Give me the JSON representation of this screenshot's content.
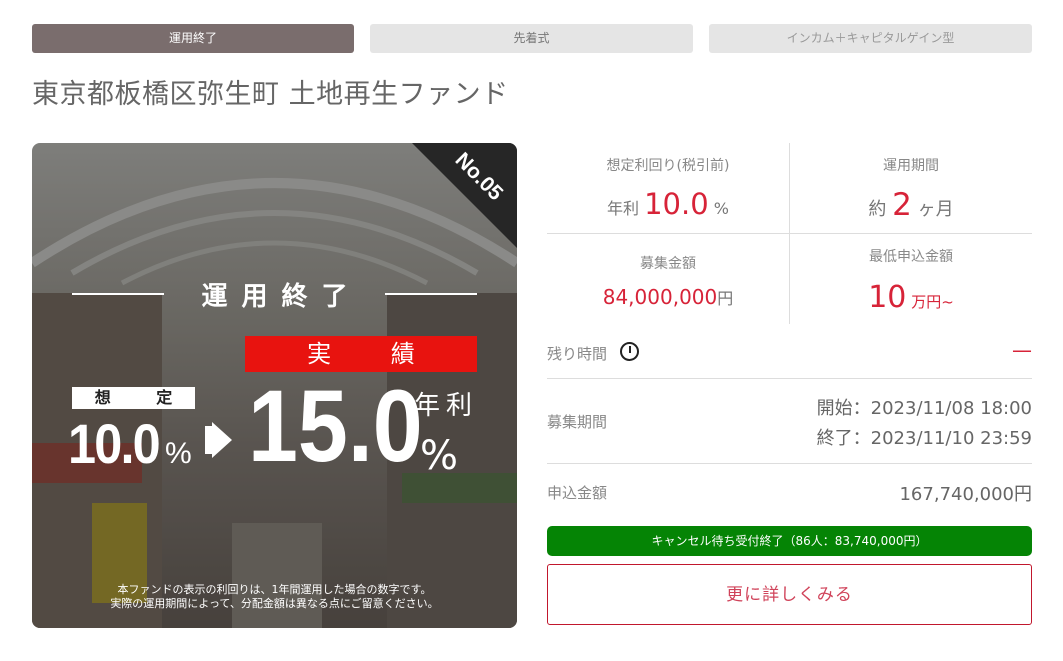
{
  "tags": {
    "status": "運用終了",
    "method": "先着式",
    "type": "インカム＋キャピタルゲイン型"
  },
  "fund_title": "東京都板橋区弥生町 土地再生ファンド",
  "hero": {
    "number_badge": "No.05",
    "status_banner": "運用終了",
    "actual_label": "実 績",
    "assumed_label": "想 定",
    "assumed_value": "10.0",
    "assumed_unit": "%",
    "actual_value": "15.0",
    "actual_unit_year": "年利",
    "actual_unit_pct": "%",
    "note_line1": "本ファンドの表示の利回りは、1年間運用した場合の数字です。",
    "note_line2": "実際の運用期間によって、分配金額は異なる点にご留意ください。"
  },
  "stats": {
    "yield_label": "想定利回り(税引前)",
    "yield_prefix": "年利",
    "yield_value": "10.0",
    "yield_unit": "%",
    "period_label": "運用期間",
    "period_prefix": "約",
    "period_value": "2",
    "period_unit": "ヶ月",
    "amount_label": "募集金額",
    "amount_value": "84,000,000",
    "amount_unit": "円",
    "min_label": "最低申込金額",
    "min_value": "10",
    "min_unit": "万円~"
  },
  "remaining": {
    "label": "残り時間",
    "value": "—"
  },
  "recruit_period": {
    "label": "募集期間",
    "start": "開始：2023/11/08 18:00",
    "end": "終了：2023/11/10 23:59"
  },
  "applied": {
    "label": "申込金額",
    "value": "167,740,000円"
  },
  "cancel_bar": "キャンセル待ち受付終了（86人：83,740,000円）",
  "detail_button": "更に詳しくみる",
  "colors": {
    "status_tag": "#7a6d6d",
    "accent_red": "#d72338",
    "hero_red": "#e8130f",
    "cancel_green": "#058405"
  }
}
